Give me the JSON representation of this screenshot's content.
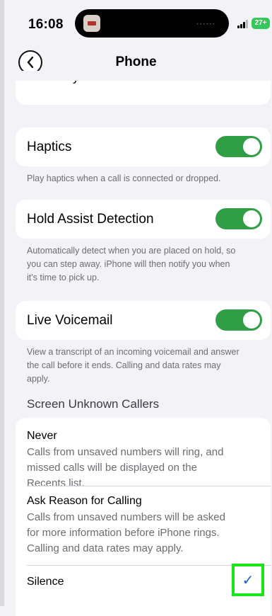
{
  "status_bar": {
    "time": "16:08",
    "battery": "27+"
  },
  "nav": {
    "back_icon": "chevron-left-icon",
    "title": "Phone"
  },
  "rows": {
    "show_caller_id": {
      "label": "Show My Caller ID"
    },
    "haptics": {
      "label": "Haptics",
      "on": true,
      "footer": "Play haptics when a call is connected or dropped."
    },
    "hold_assist": {
      "label": "Hold Assist Detection",
      "on": true,
      "footer_lines": [
        "Automatically detect when you are placed on hold, so",
        "you can step away. iPhone will then notify you when",
        "it's time to pick up."
      ]
    },
    "live_voicemail": {
      "label": "Live Voicemail",
      "on": true,
      "footer_lines": [
        "View a transcript of an incoming voicemail and answer",
        "the call before it ends. Calling and data rates may",
        "apply."
      ]
    }
  },
  "screen_unknown": {
    "header": "Screen Unknown Callers",
    "options": [
      {
        "title": "Never",
        "desc_lines": [
          "Calls from unsaved numbers will ring, and",
          "missed calls will be displayed on the",
          "Recents list."
        ],
        "selected": false
      },
      {
        "title": "Ask Reason for Calling",
        "desc_lines": [
          "Calls from unsaved numbers will be asked",
          "for more information before iPhone rings.",
          "Calling and data rates may apply."
        ],
        "selected": true
      },
      {
        "title": "Silence",
        "desc_lines": [],
        "selected": false
      }
    ],
    "check_glyph": "✓"
  },
  "colors": {
    "toggle_on": "#2f9e44",
    "highlight": "#19e619",
    "check": "#1f5fd6"
  }
}
